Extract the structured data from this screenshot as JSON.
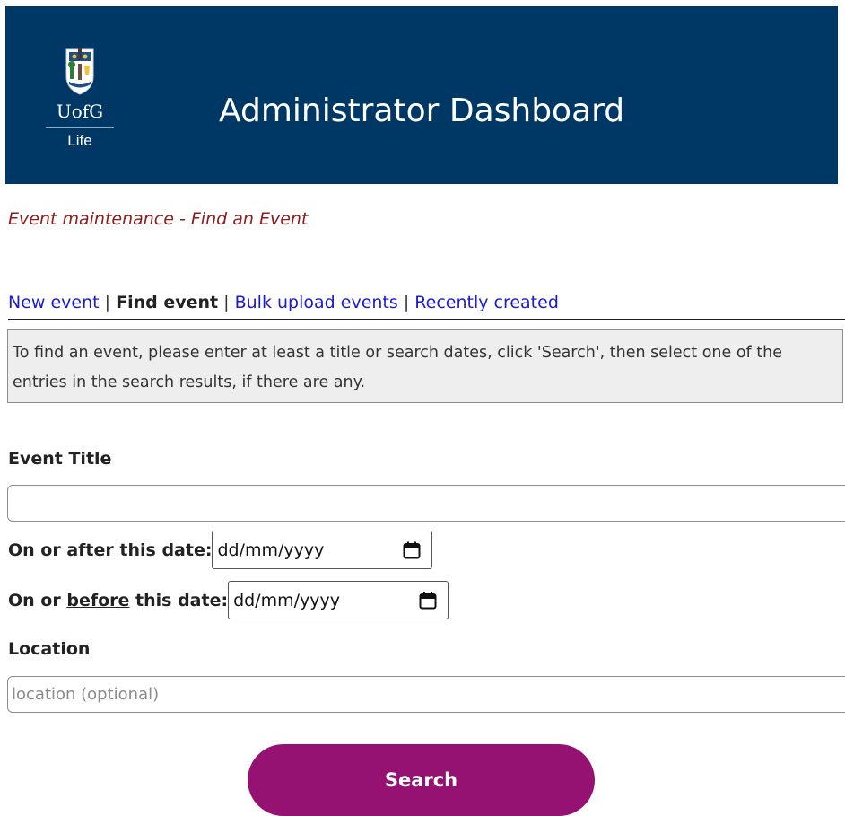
{
  "header": {
    "logo_wordmark": "UofG",
    "logo_sub": "Life",
    "title": "Administrator Dashboard"
  },
  "subtitle": "Event maintenance - Find an Event",
  "nav": {
    "items": [
      {
        "label": "New event",
        "current": false
      },
      {
        "label": "Find event",
        "current": true
      },
      {
        "label": "Bulk upload events",
        "current": false
      },
      {
        "label": "Recently created",
        "current": false
      }
    ],
    "separator": "|"
  },
  "info_text": "To find an event, please enter at least a title or search dates, click 'Search', then select one of the entries in the search results, if there are any.",
  "form": {
    "event_title_label": "Event Title",
    "event_title_value": "",
    "after_label": {
      "prefix": "On or ",
      "emphasis": "after",
      "suffix": " this date:"
    },
    "after_value": "dd/mm/yyyy",
    "before_label": {
      "prefix": "On or ",
      "emphasis": "before",
      "suffix": " this date:"
    },
    "before_value": "dd/mm/yyyy",
    "location_label": "Location",
    "location_placeholder": "location (optional)",
    "search_button": "Search"
  },
  "icons": {
    "logo": "university-crest-icon",
    "date_picker": "calendar-icon"
  },
  "colors": {
    "header_bg": "#003865",
    "subtitle": "#8b1c1c",
    "link": "#1a1ad6",
    "search_button": "#951272"
  }
}
